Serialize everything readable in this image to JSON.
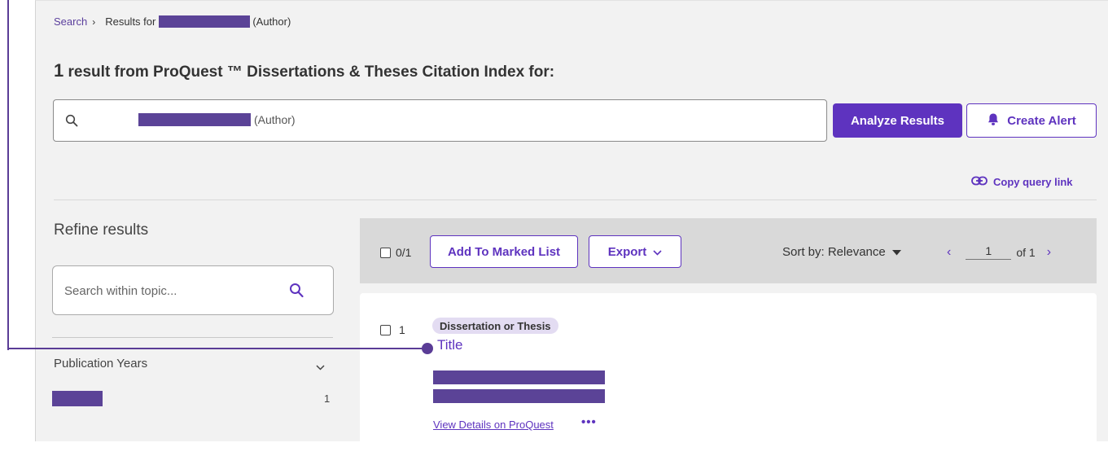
{
  "breadcrumb": {
    "search_label": "Search",
    "results_prefix": "Results for",
    "results_suffix": "(Author)"
  },
  "heading": {
    "count": "1",
    "text": "result from ProQuest ™ Dissertations & Theses Citation Index for:"
  },
  "query": {
    "suffix": "(Author)",
    "search_icon": "search-icon"
  },
  "actions": {
    "analyze_label": "Analyze Results",
    "alert_label": "Create Alert",
    "alert_icon": "bell-icon",
    "copy_link_label": "Copy query link",
    "copy_link_icon": "link-icon"
  },
  "refine": {
    "title": "Refine results",
    "search_placeholder": "Search within topic...",
    "facet_label": "Publication Years",
    "facet_count": "1"
  },
  "toolbar": {
    "selected_count": "0/1",
    "add_label": "Add To Marked List",
    "export_label": "Export",
    "sort_label": "Sort by: Relevance",
    "page": "1",
    "of_label": "of 1"
  },
  "result": {
    "index": "1",
    "doc_type": "Dissertation or Thesis",
    "title": "Title",
    "view_link": "View Details on ProQuest",
    "more_label": "•••"
  },
  "colors": {
    "accent": "#5e33bf",
    "redaction": "#5b4397",
    "toolbar_bg": "#d9d9d9",
    "page_bg": "#f2f2f2"
  }
}
